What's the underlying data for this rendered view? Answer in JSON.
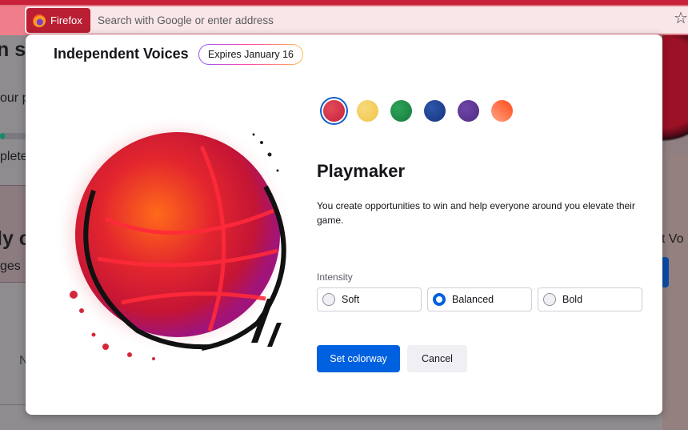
{
  "browser": {
    "identity_label": "Firefox",
    "url_placeholder": "Search with Google or enter address",
    "accent_color": "#c8213a"
  },
  "background_page": {
    "heading_1": "n se",
    "text_1": "our p",
    "progress_text": "plete",
    "heading_2": "ly c",
    "text_2": "ges",
    "text_3": "N",
    "right_text": "nt Vo"
  },
  "dialog": {
    "title": "Independent Voices",
    "expires_badge": "Expires January 16",
    "hero_icon": "basketball-illustration",
    "swatches": [
      {
        "name": "red",
        "color": "#c8213a",
        "selected": true
      },
      {
        "name": "yellow",
        "color": "#f2c94c",
        "selected": false
      },
      {
        "name": "green",
        "color": "#1e8a45",
        "selected": false
      },
      {
        "name": "blue",
        "color": "#1d3f8f",
        "selected": false
      },
      {
        "name": "purple",
        "color": "#5b3490",
        "selected": false
      },
      {
        "name": "orange",
        "color": "#ff5a24",
        "selected": false
      }
    ],
    "colorway_name": "Playmaker",
    "colorway_description": "You create opportunities to win and help everyone around you elevate their game.",
    "intensity_label": "Intensity",
    "intensity_options": [
      {
        "label": "Soft",
        "checked": false
      },
      {
        "label": "Balanced",
        "checked": true
      },
      {
        "label": "Bold",
        "checked": false
      }
    ],
    "primary_button": "Set colorway",
    "secondary_button": "Cancel"
  }
}
